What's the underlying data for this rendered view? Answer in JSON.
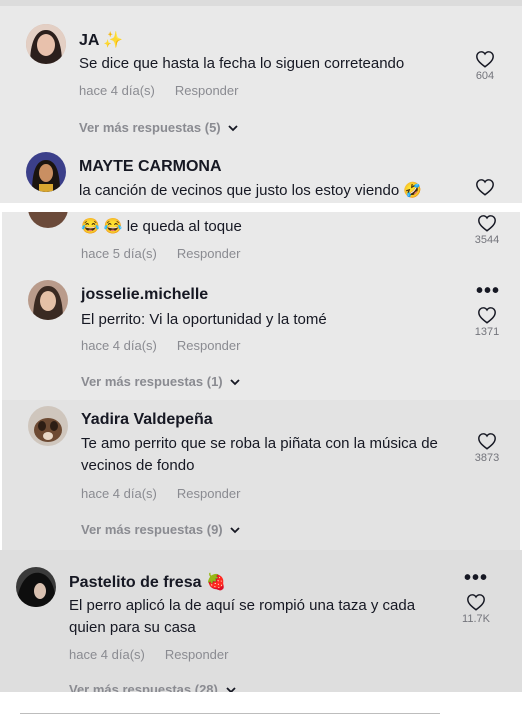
{
  "comments": [
    {
      "username": "JA ✨",
      "text": "Se dice que hasta la fecha lo siguen correteando",
      "time": "hace 4 día(s)",
      "reply": "Responder",
      "likes": "604",
      "more_replies": "Ver más respuestas (5)"
    },
    {
      "username": "MAYTE CARMONA",
      "text": "la canción de vecinos que justo los estoy viendo 🤣"
    },
    {
      "text": "😂 😂 le queda al toque",
      "time": "hace 5 día(s)",
      "reply": "Responder",
      "likes": "3544"
    },
    {
      "username": "josselie.michelle",
      "text": "El perrito: Vi la oportunidad y la tomé",
      "time": "hace 4 día(s)",
      "reply": "Responder",
      "likes": "1371",
      "more_replies": "Ver más respuestas (1)"
    },
    {
      "username": "Yadira Valdepeña",
      "text": "Te amo perrito que se roba la piñata con la música de vecinos de fondo",
      "time": "hace 4 día(s)",
      "reply": "Responder",
      "likes": "3873",
      "more_replies": "Ver más respuestas (9)"
    },
    {
      "username": "Pastelito de fresa 🍓",
      "text": "El perro aplicó la de aquí se rompió una taza y cada quien para su casa",
      "time": "hace 4 día(s)",
      "reply": "Responder",
      "likes": "11.7K",
      "more_replies": "Ver más respuestas (28)"
    }
  ],
  "colors": {
    "panel_bg": "#e9e9e9",
    "panel_alt_bg": "#e0e0e0",
    "name": "#161823",
    "meta": "#8a8b91"
  },
  "icons": [
    "heart-outline-icon",
    "chevron-down-icon",
    "more-options-icon"
  ]
}
